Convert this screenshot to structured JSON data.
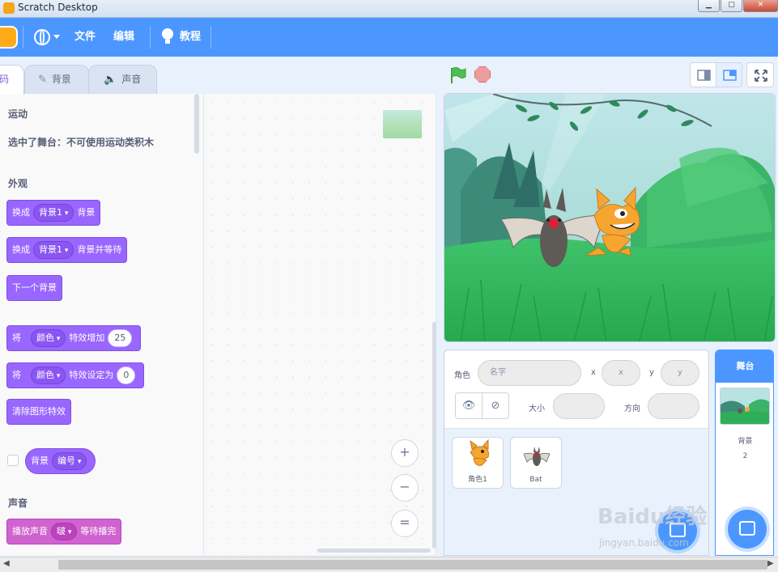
{
  "window": {
    "title": "Scratch Desktop",
    "min": "▁",
    "max": "▢",
    "close": "✕"
  },
  "menu": {
    "file": "文件",
    "edit": "编辑",
    "tutorials": "教程"
  },
  "tabs": {
    "code": "码",
    "backdrops": "背景",
    "sounds": "声音"
  },
  "palette": {
    "motion_header": "运动",
    "motion_note": "选中了舞台：不可使用运动类积木",
    "looks_header": "外观",
    "sound_header": "声音",
    "blocks": {
      "switch_backdrop": {
        "pre": "换成",
        "dd": "背景1",
        "post": "背景"
      },
      "switch_backdrop_wait": {
        "pre": "换成",
        "dd": "背景1",
        "post": "背景并等待"
      },
      "next_backdrop": "下一个背景",
      "change_effect": {
        "pre": "将",
        "dd": "颜色",
        "mid": "特效增加",
        "num": "25"
      },
      "set_effect": {
        "pre": "将",
        "dd": "颜色",
        "mid": "特效设定为",
        "num": "0"
      },
      "clear_effects": "清除图形特效",
      "backdrop_reporter": {
        "pre": "背景",
        "dd": "编号"
      },
      "play_sound": {
        "pre": "播放声音",
        "dd": "啵",
        "post": "等待播完"
      }
    }
  },
  "code_area": {
    "zoom_in": "+",
    "zoom_out": "−",
    "zoom_reset": "="
  },
  "sprite_info": {
    "sprite_label": "角色",
    "name_placeholder": "名字",
    "x_label": "x",
    "x_placeholder": "x",
    "y_label": "y",
    "y_placeholder": "y",
    "size_label": "大小",
    "direction_label": "方向",
    "show_icon": "👁",
    "hide_icon": "⊘"
  },
  "sprites": [
    {
      "name": "角色1",
      "icon": "cat-sprite-icon"
    },
    {
      "name": "Bat",
      "icon": "bat-sprite-icon"
    }
  ],
  "stage_selector": {
    "header": "舞台",
    "backdrops_label": "背景",
    "backdrops_count": "2"
  },
  "watermark": {
    "main": "Baidu经验",
    "sub": "jingyan.baidu.com"
  },
  "colors": {
    "accent": "#4c97ff",
    "looks": "#9966ff",
    "sound": "#cf63cf"
  }
}
